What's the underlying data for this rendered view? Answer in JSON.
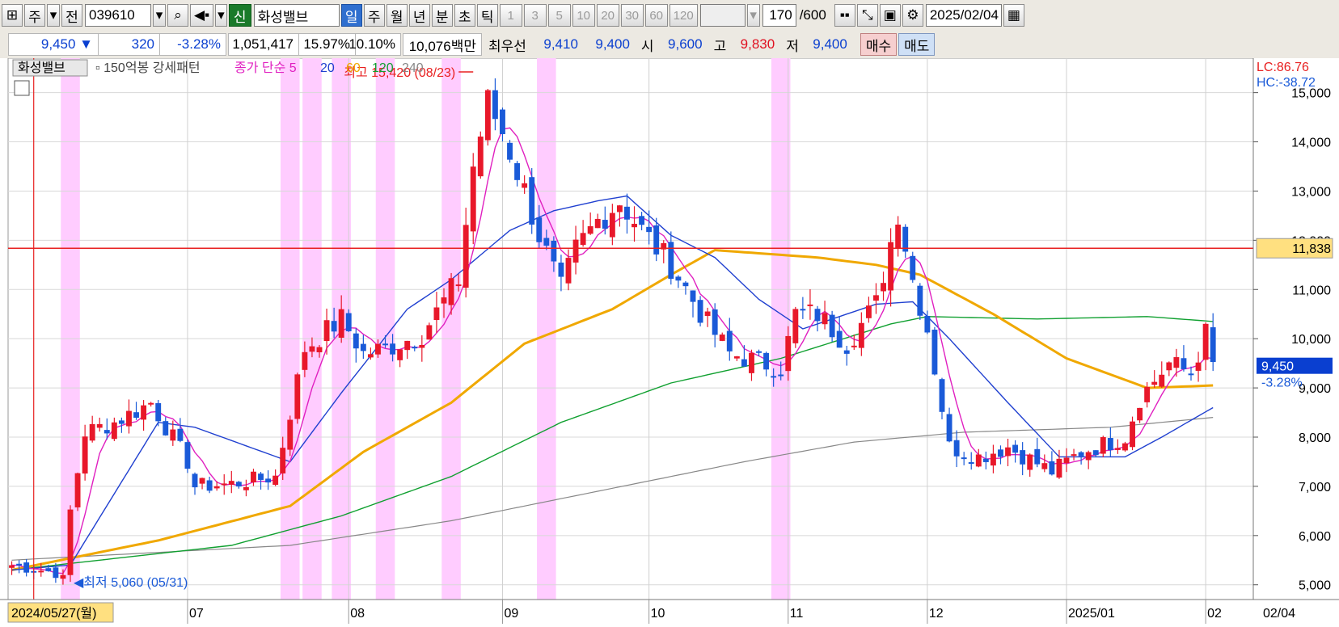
{
  "toolbar": {
    "period_week_label": "주",
    "prev_label": "전",
    "code": "039610",
    "new_badge": "신",
    "stock_name": "화성밸브",
    "periods": [
      "일",
      "주",
      "월",
      "년",
      "분",
      "초",
      "틱"
    ],
    "active_period": "일",
    "minute_steps": [
      "1",
      "3",
      "5",
      "10",
      "20",
      "30",
      "60",
      "120"
    ],
    "count_value": "170",
    "count_total": "/600",
    "date": "2025/02/04"
  },
  "quote": {
    "price": "9,450",
    "direction_glyph": "▼",
    "change": "320",
    "change_pct": "-3.28%",
    "volume": "1,051,417",
    "pct1": "15.97%",
    "pct2": "10.10%",
    "amount": "10,076백만",
    "best_bid_label": "최우선",
    "best_ask": "9,410",
    "best_bid": "9,400",
    "open_label": "시",
    "open": "9,600",
    "high_label": "고",
    "high": "9,830",
    "low_label": "저",
    "low": "9,400",
    "buy_label": "매수",
    "sell_label": "매도"
  },
  "legend": {
    "name": "화성밸브",
    "pattern": "150억봉 강세패턴",
    "ma_prefix": "종가 단순",
    "ma_5": "5",
    "ma_20": "20",
    "ma_60": "60",
    "ma_120": "120",
    "ma_240": "240"
  },
  "colors": {
    "up": "#e8182a",
    "down": "#1a5ad8",
    "ma5": "#e020c0",
    "ma20": "#2040d0",
    "ma60": "#f0a800",
    "ma120": "#10a030",
    "ma240": "#888888",
    "highlight": "#ffccff",
    "hline": "#e82020",
    "tag": "#ffe080"
  },
  "chart_data": {
    "type": "candlestick",
    "y_axis_ticks": [
      "15,000",
      "14,000",
      "13,000",
      "12,000",
      "11,000",
      "10,000",
      "9,000",
      "8,000",
      "7,000",
      "6,000",
      "5,000"
    ],
    "ylim": [
      4700,
      15700
    ],
    "x_labels": [
      {
        "label": "2024/05/27(월)",
        "idx": 0
      },
      {
        "label": "07",
        "idx": 24
      },
      {
        "label": "08",
        "idx": 46
      },
      {
        "label": "09",
        "idx": 67
      },
      {
        "label": "10",
        "idx": 87
      },
      {
        "label": "11",
        "idx": 106
      },
      {
        "label": "12",
        "idx": 125
      },
      {
        "label": "2025/01",
        "idx": 144
      },
      {
        "label": "02",
        "idx": 163
      },
      {
        "label": "02/04",
        "idx": 169
      }
    ],
    "annotations": {
      "lc": "LC:86.76",
      "hc": "HC:-38.72",
      "high_text": "최고 15,420 (08/23)",
      "low_text": "최저 5,060 (05/31)",
      "hline_label": "11,838",
      "hline_value": 11838,
      "last_price_label": "9,450",
      "last_change_label": "-3.28%",
      "last_price_value": 9450
    },
    "highlight_idx": [
      8,
      38,
      41,
      45,
      51,
      60,
      73,
      105
    ],
    "waypoints": [
      [
        0,
        5400
      ],
      [
        6,
        5250
      ],
      [
        7,
        5100
      ],
      [
        8,
        6500
      ],
      [
        10,
        8100
      ],
      [
        14,
        8300
      ],
      [
        19,
        8700
      ],
      [
        24,
        7500
      ],
      [
        25,
        7000
      ],
      [
        30,
        7050
      ],
      [
        36,
        7200
      ],
      [
        40,
        9800
      ],
      [
        45,
        10400
      ],
      [
        48,
        9700
      ],
      [
        51,
        9800
      ],
      [
        56,
        10100
      ],
      [
        61,
        11200
      ],
      [
        63,
        13500
      ],
      [
        65,
        14800
      ],
      [
        67,
        14200
      ],
      [
        70,
        13000
      ],
      [
        72,
        12100
      ],
      [
        75,
        11000
      ],
      [
        77,
        11800
      ],
      [
        80,
        12400
      ],
      [
        83,
        12800
      ],
      [
        86,
        12200
      ],
      [
        90,
        11500
      ],
      [
        95,
        10300
      ],
      [
        98,
        9700
      ],
      [
        105,
        9400
      ],
      [
        107,
        10500
      ],
      [
        110,
        10500
      ],
      [
        114,
        9900
      ],
      [
        118,
        10700
      ],
      [
        121,
        12600
      ],
      [
        123,
        11200
      ],
      [
        125,
        10200
      ],
      [
        128,
        7800
      ],
      [
        132,
        7600
      ],
      [
        136,
        7800
      ],
      [
        142,
        7300
      ],
      [
        146,
        7700
      ],
      [
        152,
        8000
      ],
      [
        154,
        8800
      ],
      [
        158,
        9500
      ],
      [
        161,
        9300
      ],
      [
        163,
        10100
      ],
      [
        164,
        9450
      ]
    ],
    "ma_lines": {
      "ma20": [
        [
          0,
          5300
        ],
        [
          8,
          5400
        ],
        [
          20,
          8300
        ],
        [
          25,
          8200
        ],
        [
          38,
          7500
        ],
        [
          45,
          8900
        ],
        [
          54,
          10600
        ],
        [
          60,
          11200
        ],
        [
          68,
          12200
        ],
        [
          74,
          12600
        ],
        [
          80,
          12800
        ],
        [
          84,
          12900
        ],
        [
          90,
          12100
        ],
        [
          96,
          11650
        ],
        [
          102,
          10800
        ],
        [
          108,
          10200
        ],
        [
          118,
          10700
        ],
        [
          123,
          10750
        ],
        [
          128,
          10000
        ],
        [
          136,
          8700
        ],
        [
          143,
          7600
        ],
        [
          152,
          7600
        ],
        [
          157,
          8000
        ],
        [
          164,
          8600
        ]
      ],
      "ma60": [
        [
          0,
          5300
        ],
        [
          20,
          5900
        ],
        [
          38,
          6600
        ],
        [
          48,
          7700
        ],
        [
          60,
          8700
        ],
        [
          70,
          9900
        ],
        [
          82,
          10600
        ],
        [
          90,
          11300
        ],
        [
          96,
          11800
        ],
        [
          110,
          11650
        ],
        [
          118,
          11500
        ],
        [
          124,
          11300
        ],
        [
          134,
          10500
        ],
        [
          144,
          9600
        ],
        [
          155,
          9000
        ],
        [
          164,
          9050
        ]
      ],
      "ma120": [
        [
          0,
          5300
        ],
        [
          30,
          5800
        ],
        [
          45,
          6400
        ],
        [
          60,
          7200
        ],
        [
          75,
          8300
        ],
        [
          90,
          9100
        ],
        [
          105,
          9600
        ],
        [
          120,
          10300
        ],
        [
          125,
          10450
        ],
        [
          140,
          10400
        ],
        [
          155,
          10450
        ],
        [
          164,
          10350
        ]
      ],
      "ma240": [
        [
          0,
          5500
        ],
        [
          38,
          5800
        ],
        [
          60,
          6300
        ],
        [
          80,
          6900
        ],
        [
          100,
          7500
        ],
        [
          115,
          7900
        ],
        [
          130,
          8100
        ],
        [
          150,
          8200
        ],
        [
          164,
          8400
        ]
      ]
    }
  }
}
